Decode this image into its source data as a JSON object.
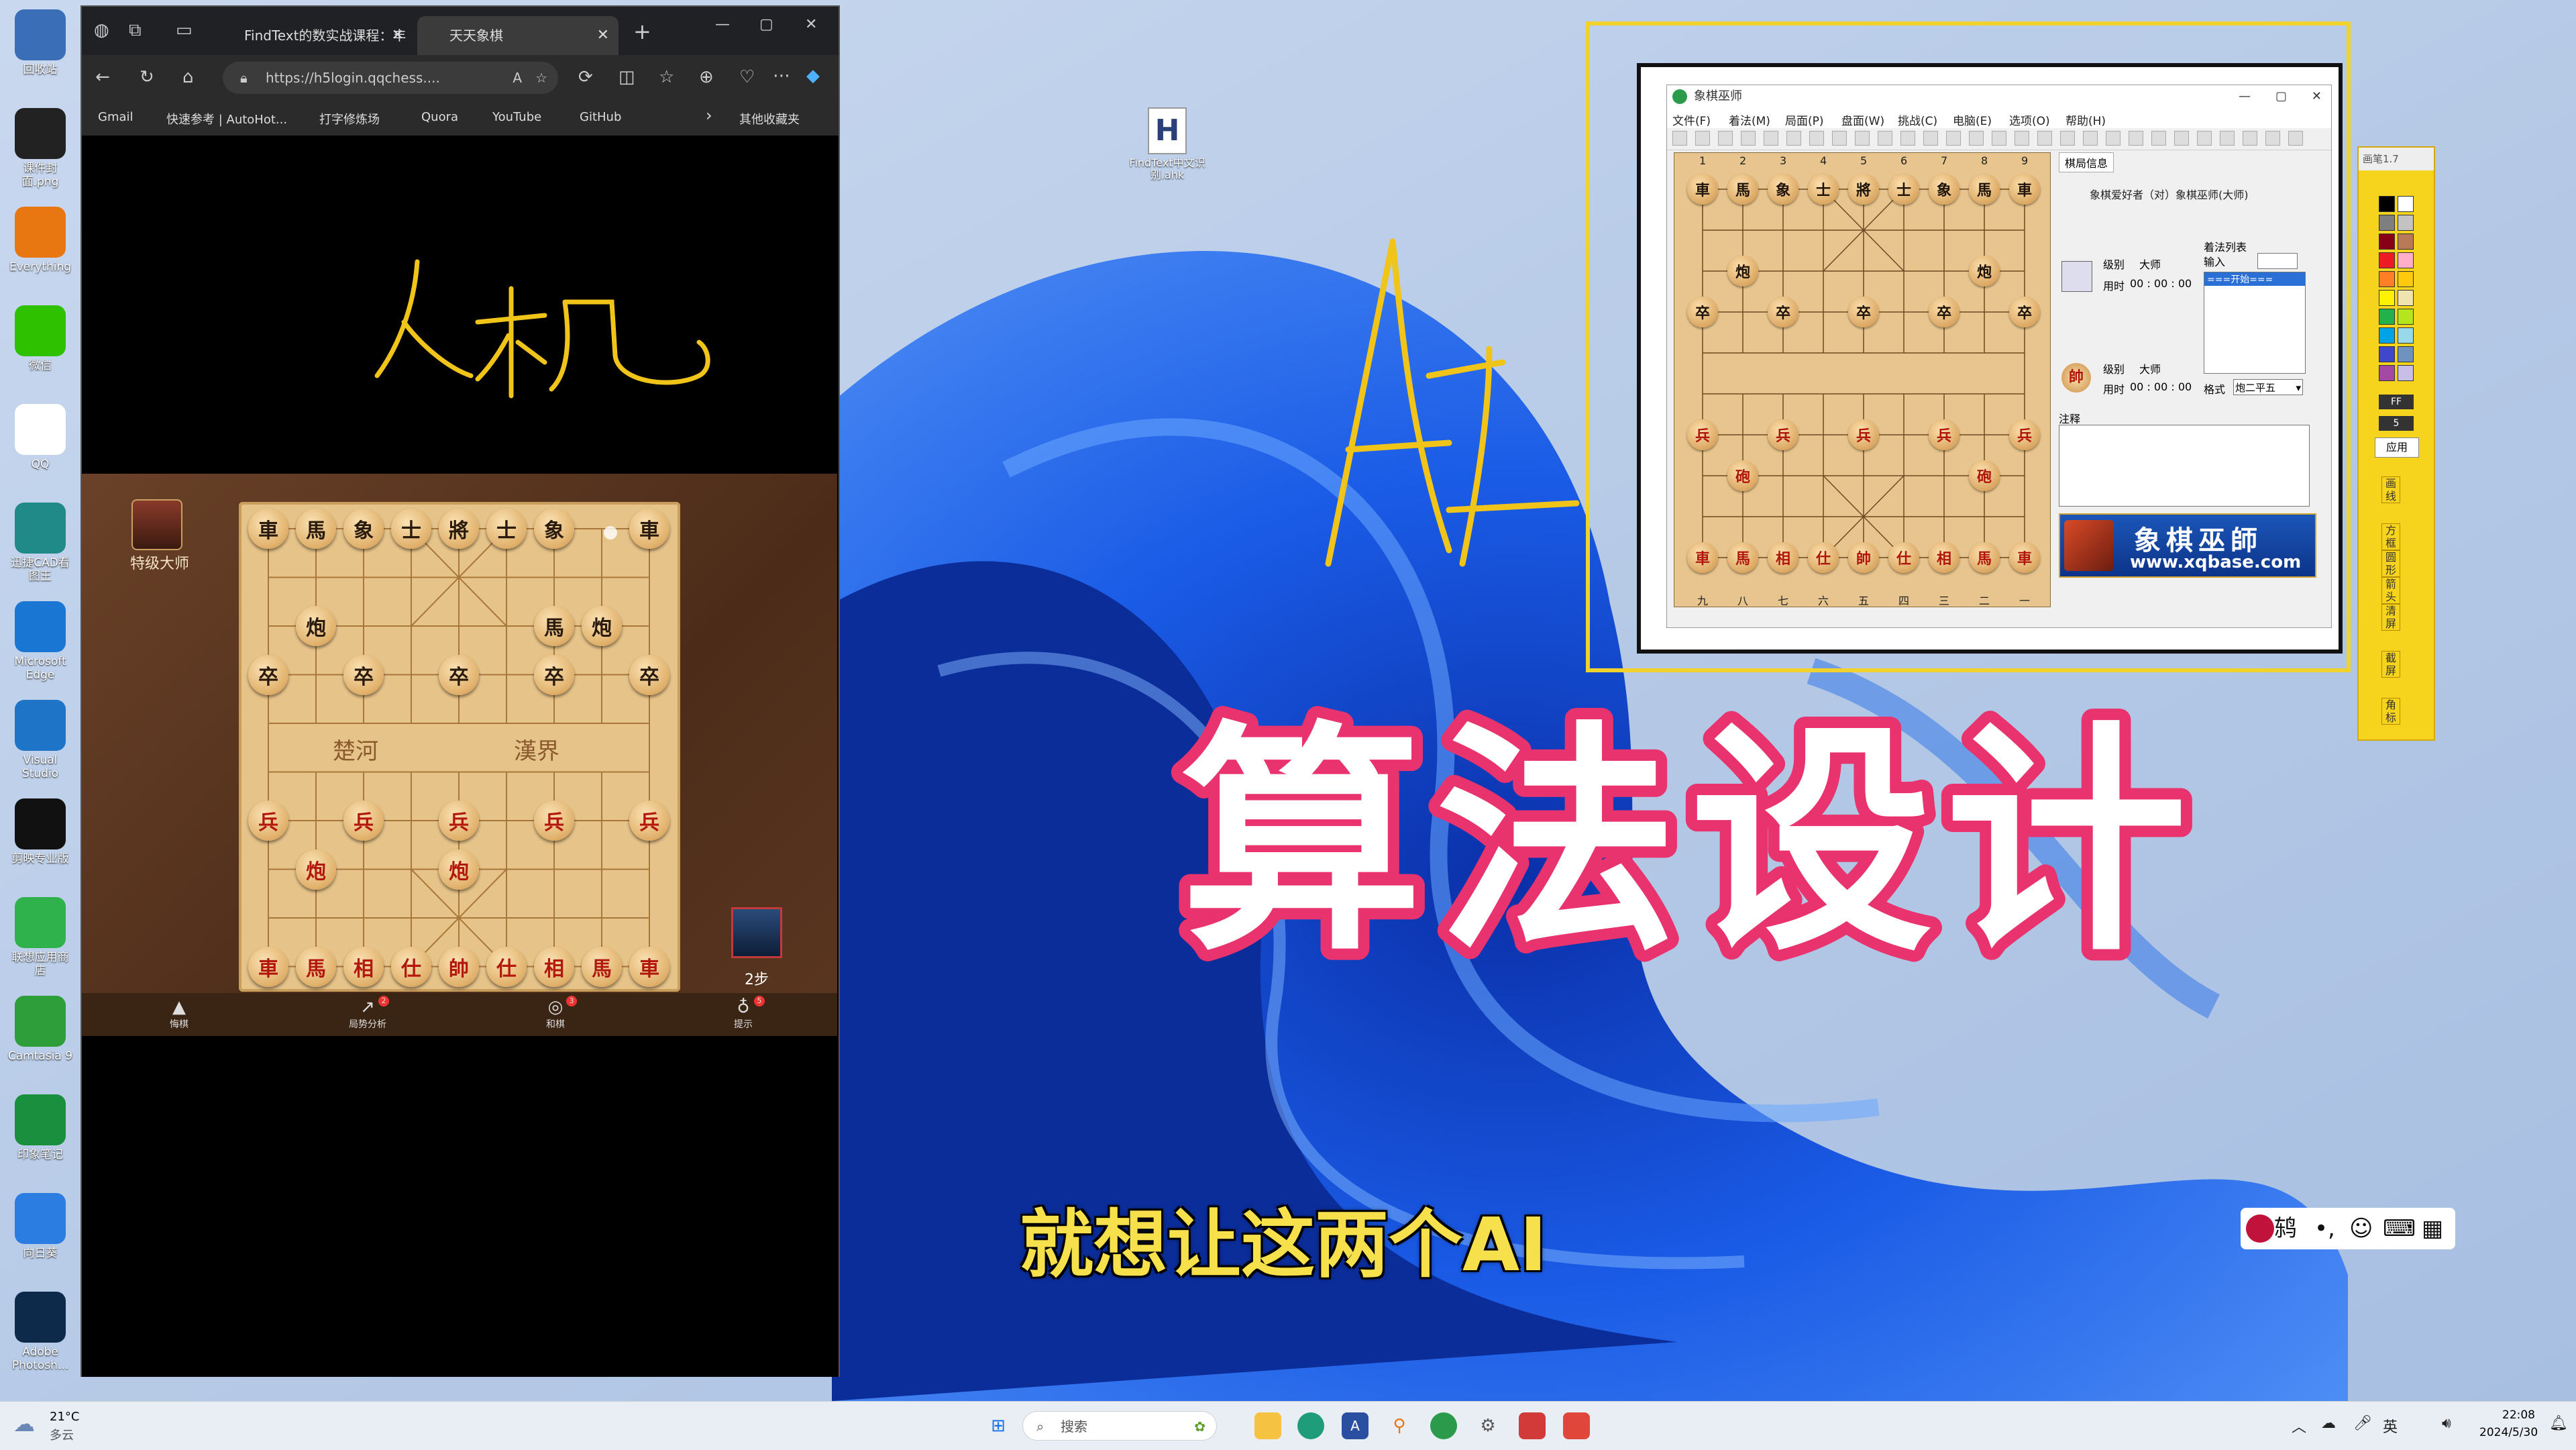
{
  "colors": {
    "wallpaper": "#0a3fbf",
    "title_fill": "#ffffff",
    "title_stroke": "#e8336e",
    "subtitle": "#f6e04b",
    "frame_yellow": "#f1d12b"
  },
  "desktop": {
    "icons": [
      {
        "name": "recycle-bin",
        "label": "回收站",
        "icon": "recycle-bin-icon",
        "color": "#3a6fb8"
      },
      {
        "name": "file-png",
        "label": "课件封面.png",
        "icon": "image-file-icon",
        "color": "#222"
      },
      {
        "name": "everything",
        "label": "Everything",
        "icon": "search-icon",
        "color": "#e87711"
      },
      {
        "name": "wechat",
        "label": "微信",
        "icon": "wechat-icon",
        "color": "#2dc100"
      },
      {
        "name": "qq",
        "label": "QQ",
        "icon": "qq-penguin-icon",
        "color": "#fff"
      },
      {
        "name": "cad",
        "label": "迅捷CAD看图王",
        "icon": "cad-icon",
        "color": "#1f8a88"
      },
      {
        "name": "edge",
        "label": "Microsoft Edge",
        "icon": "edge-icon",
        "color": "#1976d2"
      },
      {
        "name": "vscode",
        "label": "Visual Studio",
        "icon": "vscode-icon",
        "color": "#1e74c6"
      },
      {
        "name": "capcut",
        "label": "剪映专业版",
        "icon": "capcut-icon",
        "color": "#111"
      },
      {
        "name": "wxwork",
        "label": "联想应用商店",
        "icon": "store-icon",
        "color": "#2fb24c"
      },
      {
        "name": "camtasia",
        "label": "Camtasia 9",
        "icon": "camtasia-icon",
        "color": "#2e9e3a"
      },
      {
        "name": "evernote",
        "label": "印象笔记",
        "icon": "evernote-icon",
        "color": "#1a8f3e"
      },
      {
        "name": "app-share",
        "label": "向日葵",
        "icon": "sunflower-icon",
        "color": "#2b7de1"
      },
      {
        "name": "photoshop",
        "label": "Adobe Photosh...",
        "icon": "photoshop-icon",
        "color": "#0d2a4a"
      }
    ],
    "file_icon": {
      "label": "FindText中文识别.ahk",
      "letter": "H"
    }
  },
  "browser": {
    "tabs": [
      {
        "label": "FindText的数实战课程：丰",
        "active": false
      },
      {
        "label": "天天象棋",
        "active": true
      }
    ],
    "new_tab": "+",
    "window_controls": {
      "min": "—",
      "max": "▢",
      "close": "✕"
    },
    "url": "https://h5login.qqchess....",
    "bookmarks": [
      "Gmail",
      "快速参考 | AutoHot...",
      "打字修炼场",
      "Quora",
      "YouTube",
      "GitHub"
    ],
    "bookmarks_overflow": "›",
    "other_favorites": "其他收藏夹"
  },
  "handwriting": {
    "renji": "人机",
    "ai": "AI"
  },
  "game": {
    "opponent_title": "特级大师",
    "step_count": "2步",
    "river_left": "楚河",
    "river_right": "漢界",
    "nav": [
      {
        "label": "悔棋",
        "badge": ""
      },
      {
        "label": "局势分析",
        "badge": "2"
      },
      {
        "label": "和棋",
        "badge": "3"
      },
      {
        "label": "提示",
        "badge": "5"
      }
    ],
    "black_pieces": [
      {
        "t": "車",
        "c": 0,
        "r": 0
      },
      {
        "t": "馬",
        "c": 1,
        "r": 0
      },
      {
        "t": "象",
        "c": 2,
        "r": 0
      },
      {
        "t": "士",
        "c": 3,
        "r": 0
      },
      {
        "t": "將",
        "c": 4,
        "r": 0
      },
      {
        "t": "士",
        "c": 5,
        "r": 0
      },
      {
        "t": "象",
        "c": 6,
        "r": 0
      },
      {
        "t": "車",
        "c": 8,
        "r": 0
      },
      {
        "t": "炮",
        "c": 1,
        "r": 2
      },
      {
        "t": "馬",
        "c": 6,
        "r": 2
      },
      {
        "t": "炮",
        "c": 7,
        "r": 2
      },
      {
        "t": "卒",
        "c": 0,
        "r": 3
      },
      {
        "t": "卒",
        "c": 2,
        "r": 3
      },
      {
        "t": "卒",
        "c": 4,
        "r": 3
      },
      {
        "t": "卒",
        "c": 6,
        "r": 3
      },
      {
        "t": "卒",
        "c": 8,
        "r": 3
      }
    ],
    "red_pieces": [
      {
        "t": "兵",
        "c": 0,
        "r": 6
      },
      {
        "t": "兵",
        "c": 2,
        "r": 6
      },
      {
        "t": "兵",
        "c": 4,
        "r": 6
      },
      {
        "t": "兵",
        "c": 6,
        "r": 6
      },
      {
        "t": "兵",
        "c": 8,
        "r": 6
      },
      {
        "t": "炮",
        "c": 1,
        "r": 7
      },
      {
        "t": "炮",
        "c": 4,
        "r": 7
      },
      {
        "t": "車",
        "c": 0,
        "r": 9
      },
      {
        "t": "馬",
        "c": 1,
        "r": 9
      },
      {
        "t": "相",
        "c": 2,
        "r": 9
      },
      {
        "t": "仕",
        "c": 3,
        "r": 9
      },
      {
        "t": "帥",
        "c": 4,
        "r": 9
      },
      {
        "t": "仕",
        "c": 5,
        "r": 9
      },
      {
        "t": "相",
        "c": 6,
        "r": 9
      },
      {
        "t": "馬",
        "c": 7,
        "r": 9
      },
      {
        "t": "車",
        "c": 8,
        "r": 9
      }
    ]
  },
  "xq": {
    "title": "象棋巫师",
    "menus": [
      "文件(F)",
      "着法(M)",
      "局面(P)",
      "盘面(W)",
      "挑战(C)",
      "电脑(E)",
      "选项(O)",
      "帮助(H)"
    ],
    "top_coords": [
      "1",
      "2",
      "3",
      "4",
      "5",
      "6",
      "7",
      "8",
      "9"
    ],
    "bottom_coords": [
      "九",
      "八",
      "七",
      "六",
      "五",
      "四",
      "三",
      "二",
      "一"
    ],
    "tab_label": "棋局信息",
    "match_line": "象棋爱好者（对）象棋巫师(大师)",
    "level_label": "级别",
    "level_value": "大师",
    "time_label": "用时",
    "time_value": "00 : 00 : 00",
    "movelist_label": "着法列表",
    "input_label": "输入",
    "movelist_first": "===开始===",
    "format_label": "格式",
    "format_value": "炮二平五",
    "notes_label": "注释",
    "banner_cn": "象棋巫師",
    "banner_url": "www.xqbase.com",
    "black_pieces": [
      {
        "t": "車",
        "c": 0,
        "r": 0
      },
      {
        "t": "馬",
        "c": 1,
        "r": 0
      },
      {
        "t": "象",
        "c": 2,
        "r": 0
      },
      {
        "t": "士",
        "c": 3,
        "r": 0
      },
      {
        "t": "將",
        "c": 4,
        "r": 0
      },
      {
        "t": "士",
        "c": 5,
        "r": 0
      },
      {
        "t": "象",
        "c": 6,
        "r": 0
      },
      {
        "t": "馬",
        "c": 7,
        "r": 0
      },
      {
        "t": "車",
        "c": 8,
        "r": 0
      },
      {
        "t": "炮",
        "c": 1,
        "r": 2
      },
      {
        "t": "炮",
        "c": 7,
        "r": 2
      },
      {
        "t": "卒",
        "c": 0,
        "r": 3
      },
      {
        "t": "卒",
        "c": 2,
        "r": 3
      },
      {
        "t": "卒",
        "c": 4,
        "r": 3
      },
      {
        "t": "卒",
        "c": 6,
        "r": 3
      },
      {
        "t": "卒",
        "c": 8,
        "r": 3
      }
    ],
    "red_pieces": [
      {
        "t": "兵",
        "c": 0,
        "r": 6
      },
      {
        "t": "兵",
        "c": 2,
        "r": 6
      },
      {
        "t": "兵",
        "c": 4,
        "r": 6
      },
      {
        "t": "兵",
        "c": 6,
        "r": 6
      },
      {
        "t": "兵",
        "c": 8,
        "r": 6
      },
      {
        "t": "砲",
        "c": 1,
        "r": 7
      },
      {
        "t": "砲",
        "c": 7,
        "r": 7
      },
      {
        "t": "車",
        "c": 0,
        "r": 9
      },
      {
        "t": "馬",
        "c": 1,
        "r": 9
      },
      {
        "t": "相",
        "c": 2,
        "r": 9
      },
      {
        "t": "仕",
        "c": 3,
        "r": 9
      },
      {
        "t": "帥",
        "c": 4,
        "r": 9
      },
      {
        "t": "仕",
        "c": 5,
        "r": 9
      },
      {
        "t": "相",
        "c": 6,
        "r": 9
      },
      {
        "t": "馬",
        "c": 7,
        "r": 9
      },
      {
        "t": "車",
        "c": 8,
        "r": 9
      }
    ]
  },
  "color_panel": {
    "title": "画笔1.7",
    "swatches": [
      "#000000",
      "#ffffff",
      "#7f7f7f",
      "#c3c3c3",
      "#880015",
      "#b97a57",
      "#ed1c24",
      "#ffaec9",
      "#ff7f27",
      "#ffc90e",
      "#fff200",
      "#efe4b0",
      "#22b14c",
      "#b5e61d",
      "#00a2e8",
      "#99d9ea",
      "#3f48cc",
      "#7092be",
      "#a349a4",
      "#c8bfe7"
    ],
    "ff": "FF",
    "five": "5",
    "apply": "应用",
    "tabs": [
      "画线",
      "方框",
      "圆形",
      "箭头",
      "清屏",
      "截屏",
      "角标"
    ]
  },
  "overlay": {
    "big_title": "算法设计",
    "subtitle": "就想让这两个AI"
  },
  "ime": {
    "mode": "鸫",
    "punct": "•,",
    "emoji": "☺",
    "keyboard": "⌨",
    "grid": "▦"
  },
  "taskbar": {
    "weather_temp": "21°C",
    "weather_desc": "多云",
    "search_placeholder": "搜索",
    "lang": "英",
    "time": "22:08",
    "date": "2024/5/30"
  }
}
